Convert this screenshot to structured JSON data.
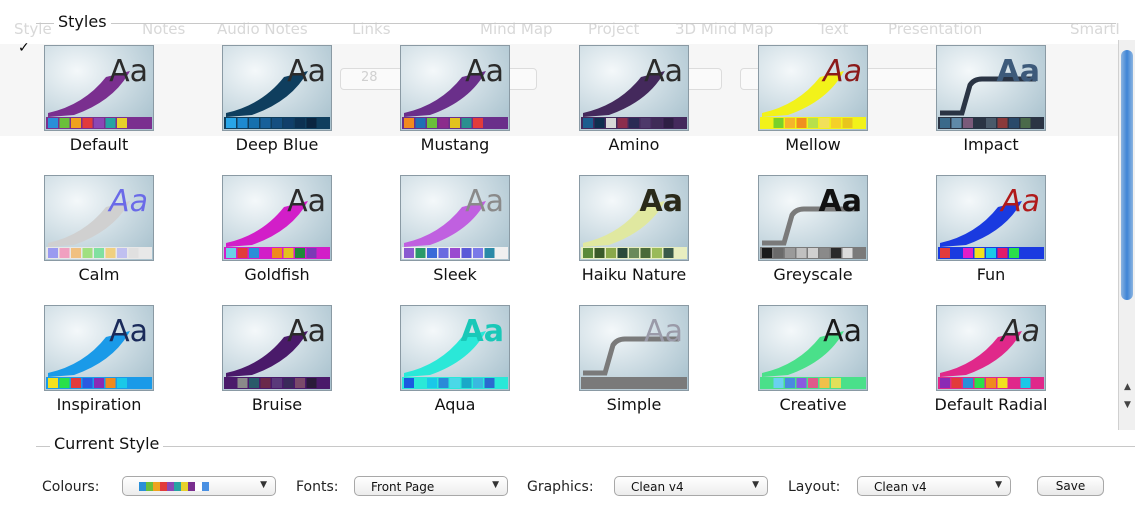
{
  "background": {
    "tabs": [
      "Style",
      "Notes",
      "Audio Notes",
      "Links",
      "Mind Map",
      "Project",
      "3D Mind Map",
      "Text",
      "Presentation",
      "SmartI"
    ],
    "font_size_value": "28"
  },
  "check_mark": "✓",
  "styles_title": "Styles",
  "styles": [
    {
      "name": "Default",
      "stroke": "#7a2f8f",
      "aa_color": "#2b2b2b",
      "aa_italic": false,
      "aa_bold": false,
      "bar_bg": "#7a2f8f",
      "swatches": [
        "#2a8fd8",
        "#6abf3a",
        "#f0a21e",
        "#e23b3b",
        "#8b47b5",
        "#27a3a3",
        "#e7d12a",
        "#7a2f8f"
      ]
    },
    {
      "name": "Deep Blue",
      "stroke": "#0f3e5e",
      "aa_color": "#2b2b2b",
      "aa_italic": false,
      "aa_bold": false,
      "bar_bg": "#0f3e5e",
      "swatches": [
        "#28a5e8",
        "#1e8ad0",
        "#1670ae",
        "#17609a",
        "#144f80",
        "#103f6a",
        "#0c3152",
        "#0a2540"
      ]
    },
    {
      "name": "Mustang",
      "stroke": "#6a2f8a",
      "aa_color": "#2b2b2b",
      "aa_italic": false,
      "aa_bold": false,
      "bar_bg": "#6a2f8a",
      "swatches": [
        "#f08a1e",
        "#1f6fb5",
        "#6abf3a",
        "#8b2c8c",
        "#e2c21e",
        "#2a8f8f",
        "#e23b3b",
        "#6a2f8a"
      ]
    },
    {
      "name": "Amino",
      "stroke": "#44295c",
      "aa_color": "#2b2b2b",
      "aa_italic": false,
      "aa_bold": false,
      "bar_bg": "#44295c",
      "swatches": [
        "#1b5d8f",
        "#0f2f4f",
        "#d8d8d8",
        "#8b2d4d",
        "#2a2a55",
        "#4d3a6a",
        "#3f2b57",
        "#2e1f44"
      ]
    },
    {
      "name": "Mellow",
      "stroke": "#f2f21a",
      "aa_color": "#8b1a1a",
      "aa_italic": true,
      "aa_bold": false,
      "bar_bg": "#f2f21a",
      "swatches": [
        "#f2f21a",
        "#7ad12a",
        "#f5b52a",
        "#f08f1e",
        "#b8e04a",
        "#f2e05a",
        "#f5d02a",
        "#e8c51e"
      ]
    },
    {
      "name": "Impact",
      "stroke": "#2a3444",
      "aa_color": "#3d5a7a",
      "aa_italic": false,
      "aa_bold": true,
      "bar_bg": "#2a3444",
      "swatches": [
        "#3a6a8a",
        "#5f89a8",
        "#7a5a7a",
        "#2a3444",
        "#4a5a6a",
        "#8a3a3a",
        "#2a4a6a",
        "#4a6a4a"
      ]
    },
    {
      "name": "Calm",
      "stroke": "#d0d0d0",
      "aa_color": "#6a6ae8",
      "aa_italic": true,
      "aa_bold": false,
      "bar_bg": "#e8e8e8",
      "swatches": [
        "#9a9af0",
        "#f0a0c0",
        "#f0c080",
        "#a0e080",
        "#80e0a0",
        "#f0d080",
        "#c0c0f0",
        "#e0e0e0"
      ]
    },
    {
      "name": "Goldfish",
      "stroke": "#d21ec8",
      "aa_color": "#2b2b2b",
      "aa_italic": false,
      "aa_bold": false,
      "bar_bg": "#d21ec8",
      "swatches": [
        "#6ad0e8",
        "#e23b3b",
        "#2a8fd8",
        "#d21ec8",
        "#f08a1e",
        "#e2c21e",
        "#1e8a3a",
        "#7a3ab5"
      ]
    },
    {
      "name": "Sleek",
      "stroke": "#c060e0",
      "aa_color": "#8a8a8a",
      "aa_italic": false,
      "aa_bold": false,
      "bar_bg": "#f0f0f0",
      "swatches": [
        "#8a5ad0",
        "#2a9a6a",
        "#3a6ad8",
        "#6a6ae0",
        "#9a4ad0",
        "#5a5ad8",
        "#7a7ae8",
        "#2a8aa8"
      ]
    },
    {
      "name": "Haiku Nature",
      "stroke": "#e0e8a0",
      "aa_color": "#2a2a1a",
      "aa_italic": false,
      "aa_bold": true,
      "bar_bg": "#e8eec0",
      "swatches": [
        "#5a8a3a",
        "#3a5a2a",
        "#8aa84a",
        "#2a4a3a",
        "#6a8a5a",
        "#4a6a3a",
        "#9aba5a",
        "#3a5a4a"
      ]
    },
    {
      "name": "Greyscale",
      "stroke": "#7a7a7a",
      "aa_color": "#111111",
      "aa_italic": false,
      "aa_bold": true,
      "bar_bg": "#7a7a7a",
      "swatches": [
        "#1a1a1a",
        "#6a6a6a",
        "#9a9a9a",
        "#c0c0c0",
        "#d0d0d0",
        "#8a8a8a",
        "#2a2a2a",
        "#dcdcdc"
      ]
    },
    {
      "name": "Fun",
      "stroke": "#1a3ae0",
      "aa_color": "#b01a1a",
      "aa_italic": true,
      "aa_bold": false,
      "bar_bg": "#1a3ae0",
      "swatches": [
        "#e23b3b",
        "#1a3ae0",
        "#e21ec8",
        "#f2e21e",
        "#1ac8e8",
        "#e21a6a",
        "#2ae04a",
        "#1a3ae0"
      ]
    },
    {
      "name": "Inspiration",
      "stroke": "#1a9ae8",
      "aa_color": "#1a2a5a",
      "aa_italic": false,
      "aa_bold": false,
      "bar_bg": "#1a9ae8",
      "swatches": [
        "#f2e21e",
        "#2ae04a",
        "#e23b3b",
        "#2a5ae0",
        "#8a2ab5",
        "#f08a1e",
        "#1ac8e8",
        "#1a9ae8"
      ]
    },
    {
      "name": "Bruise",
      "stroke": "#4a1a6a",
      "aa_color": "#2a2a2a",
      "aa_italic": false,
      "aa_bold": false,
      "bar_bg": "#4a1a6a",
      "swatches": [
        "#4a1a6a",
        "#8a8a8a",
        "#2a5a6a",
        "#6a2a4a",
        "#5a3a7a",
        "#3a2a5a",
        "#7a4a6a",
        "#2a1a3a"
      ]
    },
    {
      "name": "Aqua",
      "stroke": "#2ae8d8",
      "aa_color": "#1ac8b8",
      "aa_italic": false,
      "aa_bold": true,
      "bar_bg": "#2ae8d8",
      "swatches": [
        "#1a5ae0",
        "#2ae8d8",
        "#1ac8e8",
        "#2a8ad8",
        "#4ad8e8",
        "#1aa8c8",
        "#3ab8e0",
        "#2a6ad0"
      ]
    },
    {
      "name": "Simple",
      "stroke": "#7a7a7a",
      "aa_color": "#9a9aa8",
      "aa_italic": false,
      "aa_bold": false,
      "bar_bg": "#7a7a7a",
      "swatches": [
        "#7a7a7a",
        "#7a7a7a",
        "#7a7a7a",
        "#7a7a7a",
        "#7a7a7a",
        "#7a7a7a",
        "#7a7a7a",
        "#7a7a7a"
      ]
    },
    {
      "name": "Creative",
      "stroke": "#4ae08a",
      "aa_color": "#1a1a1a",
      "aa_italic": false,
      "aa_bold": false,
      "bar_bg": "#4ae08a",
      "swatches": [
        "#4ae08a",
        "#6ad0f0",
        "#4a8ae0",
        "#8a5ae0",
        "#e05a8a",
        "#f0c04a",
        "#e0e05a",
        "#4ae08a"
      ]
    },
    {
      "name": "Default Radial",
      "stroke": "#e0288a",
      "aa_color": "#2a2a2a",
      "aa_italic": true,
      "aa_bold": false,
      "bar_bg": "#e0288a",
      "swatches": [
        "#8a2ab5",
        "#e23b3b",
        "#2a8fd8",
        "#2ae04a",
        "#f08a1e",
        "#f2e21e",
        "#e0288a",
        "#1ac8e8"
      ]
    }
  ],
  "current_style": {
    "title": "Current Style",
    "colours_label": "Colours:",
    "colours_swatches": [
      "#2a8fd8",
      "#6abf3a",
      "#f0a21e",
      "#e23b3b",
      "#8b47b5",
      "#27a3a3",
      "#e7d12a",
      "#7a2f8f",
      "#ffffff",
      "#4a90e2"
    ],
    "fonts_label": "Fonts:",
    "fonts_value": "Front Page",
    "graphics_label": "Graphics:",
    "graphics_value": "Clean v4",
    "layout_label": "Layout:",
    "layout_value": "Clean v4",
    "save_label": "Save"
  }
}
